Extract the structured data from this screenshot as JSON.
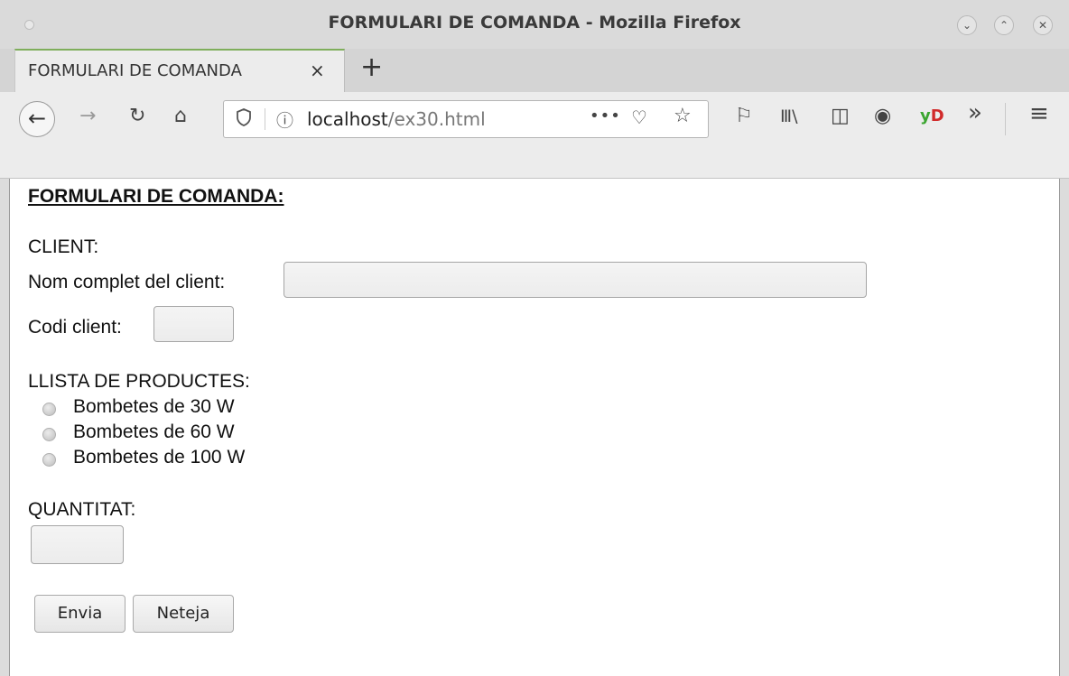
{
  "window": {
    "title": "FORMULARI DE COMANDA - Mozilla Firefox",
    "controls": {
      "minimize": "⌄",
      "maximize": "⌃",
      "close": "✕"
    }
  },
  "tabs": [
    {
      "label": "FORMULARI DE COMANDA",
      "close": "×"
    }
  ],
  "new_tab": "+",
  "navbar": {
    "back": "←",
    "forward": "→",
    "reload": "↻",
    "home": "⌂",
    "url_host": "localhost",
    "url_path": "/ex30.html",
    "page_actions": "•••",
    "pocket": "♡",
    "bookmark_star": "☆",
    "toolbar_icons": [
      "⚐",
      "Ⅲ\\",
      "◫",
      "◉"
    ],
    "yd_y": "y",
    "yd_d": "D",
    "overflow": "»",
    "menu": "≡"
  },
  "page": {
    "heading": "FORMULARI DE COMANDA:",
    "client_section": "CLIENT:",
    "client_name_label": "Nom complet del client:",
    "client_name_value": "",
    "client_code_label": "Codi client:",
    "client_code_value": "",
    "products_section": "LLISTA DE PRODUCTES:",
    "products": [
      "Bombetes de 30 W",
      "Bombetes de 60 W",
      "Bombetes de 100 W"
    ],
    "quantity_section": "QUANTITAT:",
    "quantity_value": "",
    "submit_label": "Envia",
    "reset_label": "Neteja"
  }
}
